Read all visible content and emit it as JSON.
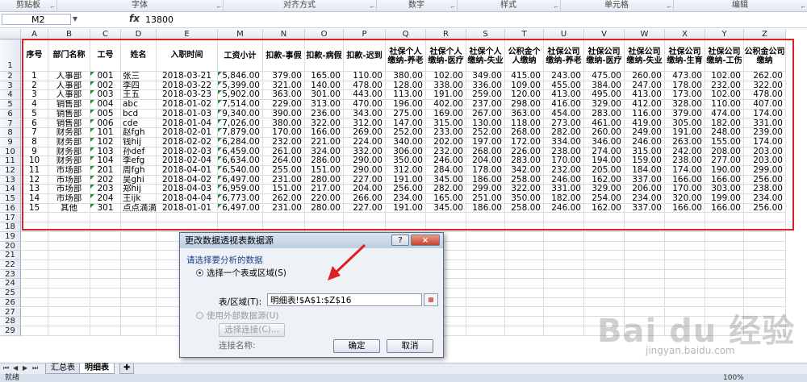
{
  "ribbon": {
    "groups": [
      "剪贴板",
      "字体",
      "对齐方式",
      "数字",
      "样式",
      "单元格",
      "编辑"
    ]
  },
  "formula_bar": {
    "name_box": "M2",
    "fx_symbol": "fx",
    "value": "13800"
  },
  "columns": [
    "A",
    "B",
    "C",
    "D",
    "E",
    "M",
    "N",
    "O",
    "P",
    "Q",
    "R",
    "S",
    "T",
    "U",
    "V",
    "W",
    "X",
    "Y",
    "Z"
  ],
  "headers": [
    "序号",
    "部门名称",
    "工号",
    "姓名",
    "入职时间",
    "工资小计",
    "扣款-事假",
    "扣款-病假",
    "扣款-迟到",
    "社保个人缴纳-养老",
    "社保个人缴纳-医疗",
    "社保个人缴纳-失业",
    "公积金个人缴纳",
    "社保公司缴纳-养老",
    "社保公司缴纳-医疗",
    "社保公司缴纳-失业",
    "社保公司缴纳-生育",
    "社保公司缴纳-工伤",
    "公积金公司缴纳"
  ],
  "rows": [
    [
      "1",
      "人事部",
      "001",
      "张三",
      "2018-03-21",
      "5,846.00",
      "379.00",
      "165.00",
      "110.00",
      "380.00",
      "102.00",
      "349.00",
      "415.00",
      "243.00",
      "475.00",
      "260.00",
      "473.00",
      "102.00",
      "262.00"
    ],
    [
      "2",
      "人事部",
      "002",
      "李四",
      "2018-03-22",
      "5,399.00",
      "321.00",
      "140.00",
      "478.00",
      "128.00",
      "338.00",
      "336.00",
      "109.00",
      "455.00",
      "384.00",
      "247.00",
      "178.00",
      "232.00",
      "322.00"
    ],
    [
      "3",
      "人事部",
      "003",
      "王五",
      "2018-03-23",
      "5,902.00",
      "363.00",
      "301.00",
      "443.00",
      "113.00",
      "191.00",
      "259.00",
      "120.00",
      "413.00",
      "495.00",
      "413.00",
      "173.00",
      "102.00",
      "478.00"
    ],
    [
      "4",
      "销售部",
      "004",
      "abc",
      "2018-01-02",
      "7,514.00",
      "229.00",
      "313.00",
      "470.00",
      "196.00",
      "402.00",
      "237.00",
      "298.00",
      "416.00",
      "329.00",
      "412.00",
      "328.00",
      "110.00",
      "407.00"
    ],
    [
      "5",
      "销售部",
      "005",
      "bcd",
      "2018-01-03",
      "9,340.00",
      "390.00",
      "236.00",
      "343.00",
      "275.00",
      "169.00",
      "267.00",
      "363.00",
      "454.00",
      "283.00",
      "116.00",
      "379.00",
      "474.00",
      "174.00"
    ],
    [
      "6",
      "销售部",
      "006",
      "cde",
      "2018-01-04",
      "7,026.00",
      "380.00",
      "322.00",
      "312.00",
      "147.00",
      "315.00",
      "130.00",
      "118.00",
      "273.00",
      "461.00",
      "419.00",
      "305.00",
      "182.00",
      "331.00"
    ],
    [
      "7",
      "财务部",
      "101",
      "赵fgh",
      "2018-02-01",
      "7,879.00",
      "170.00",
      "166.00",
      "269.00",
      "252.00",
      "233.00",
      "252.00",
      "268.00",
      "282.00",
      "260.00",
      "249.00",
      "191.00",
      "248.00",
      "239.00"
    ],
    [
      "8",
      "财务部",
      "102",
      "钱hij",
      "2018-02-02",
      "6,284.00",
      "232.00",
      "221.00",
      "224.00",
      "340.00",
      "202.00",
      "197.00",
      "172.00",
      "334.00",
      "346.00",
      "246.00",
      "263.00",
      "155.00",
      "174.00"
    ],
    [
      "9",
      "财务部",
      "103",
      "孙def",
      "2018-02-03",
      "6,459.00",
      "261.00",
      "324.00",
      "332.00",
      "306.00",
      "232.00",
      "268.00",
      "226.00",
      "238.00",
      "274.00",
      "315.00",
      "242.00",
      "208.00",
      "203.00"
    ],
    [
      "10",
      "财务部",
      "104",
      "李efg",
      "2018-02-04",
      "6,634.00",
      "264.00",
      "286.00",
      "290.00",
      "350.00",
      "246.00",
      "204.00",
      "283.00",
      "170.00",
      "194.00",
      "159.00",
      "238.00",
      "277.00",
      "203.00"
    ],
    [
      "11",
      "市场部",
      "201",
      "周fgh",
      "2018-04-01",
      "6,540.00",
      "255.00",
      "151.00",
      "290.00",
      "312.00",
      "284.00",
      "178.00",
      "342.00",
      "232.00",
      "205.00",
      "184.00",
      "174.00",
      "190.00",
      "299.00"
    ],
    [
      "12",
      "市场部",
      "202",
      "吴ghi",
      "2018-04-02",
      "6,497.00",
      "231.00",
      "280.00",
      "227.00",
      "191.00",
      "345.00",
      "186.00",
      "258.00",
      "246.00",
      "162.00",
      "337.00",
      "166.00",
      "166.00",
      "256.00"
    ],
    [
      "13",
      "市场部",
      "203",
      "郑hij",
      "2018-04-03",
      "6,959.00",
      "151.00",
      "217.00",
      "204.00",
      "256.00",
      "282.00",
      "299.00",
      "322.00",
      "331.00",
      "329.00",
      "206.00",
      "170.00",
      "303.00",
      "238.00"
    ],
    [
      "14",
      "市场部",
      "204",
      "王ijk",
      "2018-04-04",
      "6,773.00",
      "262.00",
      "220.00",
      "266.00",
      "234.00",
      "165.00",
      "251.00",
      "350.00",
      "182.00",
      "254.00",
      "234.00",
      "320.00",
      "199.00",
      "234.00"
    ],
    [
      "15",
      "其他",
      "301",
      "点点滴滴",
      "2018-01-01",
      "6,497.00",
      "231.00",
      "280.00",
      "227.00",
      "191.00",
      "345.00",
      "186.00",
      "258.00",
      "246.00",
      "162.00",
      "337.00",
      "166.00",
      "166.00",
      "256.00"
    ]
  ],
  "row_numbers": [
    "1",
    "2",
    "3",
    "4",
    "5",
    "6",
    "7",
    "8",
    "9",
    "10",
    "11",
    "12",
    "13",
    "14",
    "15",
    "16",
    "17",
    "18",
    "19",
    "20",
    "21",
    "22",
    "23",
    "24",
    "25",
    "26",
    "27",
    "28",
    "29"
  ],
  "sheet_tabs": [
    "汇总表",
    "明细表"
  ],
  "active_tab": "明细表",
  "status": {
    "mode": "就绪",
    "zoom": "100%"
  },
  "dialog": {
    "title": "更改数据透视表数据源",
    "help": "?",
    "close": "×",
    "section_label": "请选择要分析的数据",
    "option_table": "选择一个表或区域(S)",
    "range_label": "表/区域(T):",
    "range_value": "明细表!$A$1:$Z$16",
    "option_external": "使用外部数据源(U)",
    "choose_connection": "选择连接(C)...",
    "connection_name_label": "连接名称:",
    "ok": "确定",
    "cancel": "取消"
  },
  "watermark": {
    "brand": "Bai du 经验",
    "url": "jingyan.baidu.com"
  },
  "colors": {
    "selection_border": "#e02020",
    "accent": "#1a3c8a"
  }
}
